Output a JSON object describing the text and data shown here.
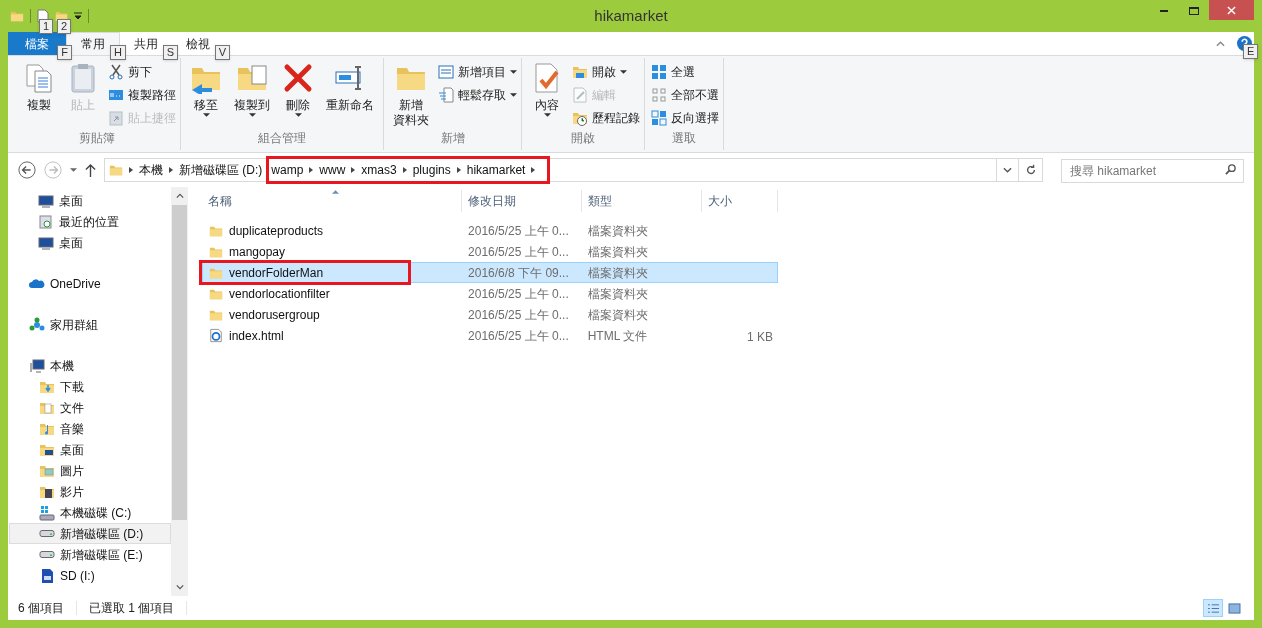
{
  "window": {
    "title": "hikamarket",
    "quick_access_keytips": [
      "1",
      "2"
    ]
  },
  "ribbon": {
    "tabs": [
      {
        "label": "檔案",
        "selected": false,
        "kind": "file",
        "keytip": "F"
      },
      {
        "label": "常用",
        "selected": true,
        "kind": "normal",
        "keytip": "H"
      },
      {
        "label": "共用",
        "selected": false,
        "kind": "normal",
        "keytip": "S"
      },
      {
        "label": "檢視",
        "selected": false,
        "kind": "normal",
        "keytip": "V"
      }
    ],
    "help_keytip": "E",
    "groups": [
      {
        "label": "剪貼簿",
        "items": [
          {
            "label": "複製",
            "kind": "large",
            "disabled": false,
            "dropdown": false
          },
          {
            "label": "貼上",
            "kind": "large",
            "disabled": true,
            "dropdown": false
          },
          {
            "label": "剪下",
            "kind": "small",
            "disabled": false,
            "dropdown": false
          },
          {
            "label": "複製路徑",
            "kind": "small",
            "disabled": false,
            "dropdown": false
          },
          {
            "label": "貼上捷徑",
            "kind": "small",
            "disabled": true,
            "dropdown": false
          }
        ]
      },
      {
        "label": "組合管理",
        "items": [
          {
            "label": "移至",
            "kind": "large",
            "disabled": false,
            "dropdown": true
          },
          {
            "label": "複製到",
            "kind": "large",
            "disabled": false,
            "dropdown": true
          },
          {
            "label": "刪除",
            "kind": "large",
            "disabled": false,
            "dropdown": true
          },
          {
            "label": "重新命名",
            "kind": "large",
            "disabled": false,
            "dropdown": false
          }
        ]
      },
      {
        "label": "新增",
        "items": [
          {
            "lines": [
              "新增",
              "資料夾"
            ],
            "kind": "large",
            "disabled": false,
            "dropdown": false
          },
          {
            "label": "新增項目",
            "kind": "small",
            "disabled": false,
            "dropdown": true
          },
          {
            "label": "輕鬆存取",
            "kind": "small",
            "disabled": false,
            "dropdown": true
          }
        ]
      },
      {
        "label": "開啟",
        "items": [
          {
            "label": "內容",
            "kind": "large",
            "disabled": false,
            "dropdown": true
          },
          {
            "label": "開啟",
            "kind": "small",
            "disabled": false,
            "dropdown": true
          },
          {
            "label": "編輯",
            "kind": "small",
            "disabled": true,
            "dropdown": false
          },
          {
            "label": "歷程記錄",
            "kind": "small",
            "disabled": false,
            "dropdown": false
          }
        ]
      },
      {
        "label": "選取",
        "items": [
          {
            "label": "全選",
            "kind": "small",
            "disabled": false,
            "dropdown": false
          },
          {
            "label": "全部不選",
            "kind": "small",
            "disabled": false,
            "dropdown": false
          },
          {
            "label": "反向選擇",
            "kind": "small",
            "disabled": false,
            "dropdown": false
          }
        ]
      }
    ]
  },
  "address": {
    "crumbs": [
      {
        "label": "本機",
        "annotated": false
      },
      {
        "label": "新增磁碟區 (D:)",
        "annotated": false
      },
      {
        "label": "wamp",
        "annotated": true
      },
      {
        "label": "www",
        "annotated": true
      },
      {
        "label": "xmas3",
        "annotated": true
      },
      {
        "label": "plugins",
        "annotated": true
      },
      {
        "label": "hikamarket",
        "annotated": true
      }
    ],
    "search_placeholder": "搜尋 hikamarket"
  },
  "nav": {
    "items": [
      {
        "label": "桌面",
        "kind": "desktop",
        "selected": false
      },
      {
        "label": "最近的位置",
        "kind": "recent",
        "selected": false
      },
      {
        "label": "桌面",
        "kind": "desktop",
        "selected": false
      },
      {
        "label": "OneDrive",
        "kind": "cloud",
        "selected": false
      },
      {
        "label": "家用群組",
        "kind": "homegroup",
        "selected": false
      },
      {
        "label": "本機",
        "kind": "computer",
        "selected": false,
        "children": [
          {
            "label": "下載",
            "kind": "downloads",
            "selected": false
          },
          {
            "label": "文件",
            "kind": "documents",
            "selected": false
          },
          {
            "label": "音樂",
            "kind": "music",
            "selected": false
          },
          {
            "label": "桌面",
            "kind": "desktopfolder",
            "selected": false
          },
          {
            "label": "圖片",
            "kind": "pictures",
            "selected": false
          },
          {
            "label": "影片",
            "kind": "videos",
            "selected": false
          },
          {
            "label": "本機磁碟 (C:)",
            "kind": "system",
            "selected": false
          },
          {
            "label": "新增磁碟區 (D:)",
            "kind": "drive",
            "selected": true
          },
          {
            "label": "新增磁碟區 (E:)",
            "kind": "drive",
            "selected": false
          },
          {
            "label": "SD (I:)",
            "kind": "sd",
            "selected": false
          }
        ]
      }
    ]
  },
  "files": {
    "columns": [
      {
        "label": "名稱",
        "sorted": true
      },
      {
        "label": "修改日期",
        "sorted": false
      },
      {
        "label": "類型",
        "sorted": false
      },
      {
        "label": "大小",
        "sorted": false
      }
    ],
    "rows": [
      {
        "name": "duplicateproducts",
        "date": "2016/5/25 上午 0...",
        "type": "檔案資料夾",
        "kind": "folder",
        "selected": false,
        "annotated": false
      },
      {
        "name": "mangopay",
        "date": "2016/5/25 上午 0...",
        "type": "檔案資料夾",
        "kind": "folder",
        "selected": false,
        "annotated": false
      },
      {
        "name": "vendorFolderMan",
        "date": "2016/6/8 下午 09...",
        "type": "檔案資料夾",
        "kind": "folder",
        "selected": true,
        "annotated": true
      },
      {
        "name": "vendorlocationfilter",
        "date": "2016/5/25 上午 0...",
        "type": "檔案資料夾",
        "kind": "folder",
        "selected": false,
        "annotated": false
      },
      {
        "name": "vendorusergroup",
        "date": "2016/5/25 上午 0...",
        "type": "檔案資料夾",
        "kind": "folder",
        "selected": false,
        "annotated": false
      },
      {
        "name": "index.html",
        "date": "2016/5/25 上午 0...",
        "type": "HTML 文件",
        "size": "1 KB",
        "kind": "html",
        "selected": false,
        "annotated": false
      }
    ]
  },
  "status_bar": {
    "count": "6 個項目",
    "selection": "已選取 1 個項目",
    "views": [
      {
        "kind": "details",
        "selected": true
      },
      {
        "kind": "tiles",
        "selected": false
      }
    ]
  }
}
